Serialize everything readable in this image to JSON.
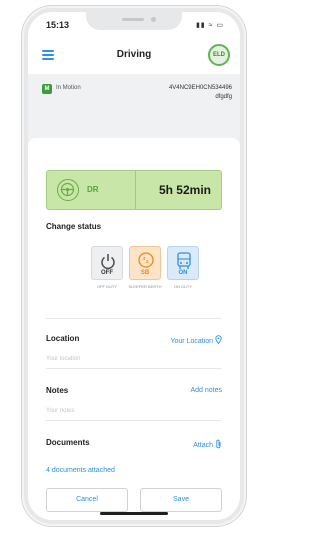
{
  "status_bar": {
    "time": "15:13",
    "icons": "▮▮ ≈ ▭"
  },
  "header": {
    "title": "Driving",
    "badge": "ELD"
  },
  "vehicle": {
    "state_badge": "M",
    "state": "In Motion",
    "vin_line1": "4V4NC9EH0CN534496",
    "vin_line2": "dfgdfg"
  },
  "current_status": {
    "code": "DR",
    "time_left": "5h 52min"
  },
  "change_status": {
    "title": "Change status",
    "options": [
      {
        "label": "OFF",
        "sub": "OFF DUTY",
        "color": "#8a8d91"
      },
      {
        "label": "SB",
        "sub": "SLEEPER BERTH",
        "color": "#f08a1c"
      },
      {
        "label": "ON",
        "sub": "ON DUTY",
        "color": "#2f8fe0"
      }
    ]
  },
  "location": {
    "title": "Location",
    "action": "Your Location",
    "placeholder": "Your location"
  },
  "notes": {
    "title": "Notes",
    "action": "Add notes",
    "placeholder": "Your notes"
  },
  "documents": {
    "title": "Documents",
    "action": "Attach",
    "attached": "4 documents attached"
  },
  "actions": {
    "cancel": "Cancel",
    "save": "Save"
  },
  "colors": {
    "accent": "#2f8fe0",
    "driving_bg": "#c8e6a7",
    "driving_text": "#5aa13b",
    "sleeper_bg": "#fde3c8",
    "on_duty_bg": "#dbeaf8"
  }
}
